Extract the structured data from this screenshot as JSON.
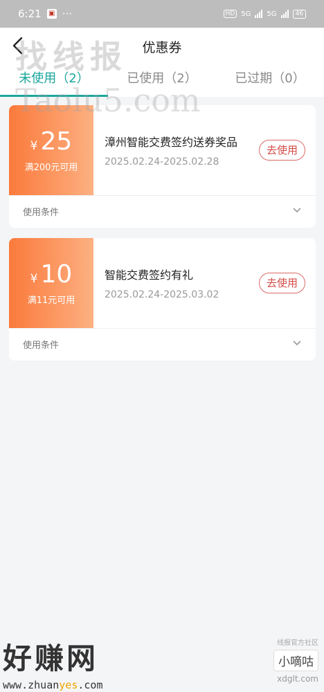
{
  "status_bar": {
    "time": "6:21",
    "dots": "···",
    "hd": "HD",
    "net1": "5G",
    "net2": "5G",
    "battery": "46"
  },
  "header": {
    "title": "优惠券"
  },
  "tabs": [
    {
      "label": "未使用（2）",
      "active": true
    },
    {
      "label": "已使用（2）",
      "active": false
    },
    {
      "label": "已过期（0）",
      "active": false
    }
  ],
  "coupons": [
    {
      "currency": "¥",
      "amount": "25",
      "threshold": "满200元可用",
      "name": "漳州智能交费签约送券奖品",
      "dates": "2025.02.24-2025.02.28",
      "button": "去使用",
      "conditions_label": "使用条件"
    },
    {
      "currency": "¥",
      "amount": "10",
      "threshold": "满11元可用",
      "name": "智能交费签约有礼",
      "dates": "2025.02.24-2025.03.02",
      "button": "去使用",
      "conditions_label": "使用条件"
    }
  ],
  "watermarks": {
    "top": "找线报",
    "mid": "Taolu5.com",
    "brand": "好赚网",
    "url_prefix": "www.zhuan",
    "url_accent": "yes",
    "url_suffix": ".com",
    "small": "线报官方社区",
    "xdt": "小嘀咕",
    "xdt_url": "xdglt.com"
  },
  "colors": {
    "accent": "#1aa69c",
    "coupon_orange": "#fb7a3c",
    "button_red": "#d24b45"
  }
}
